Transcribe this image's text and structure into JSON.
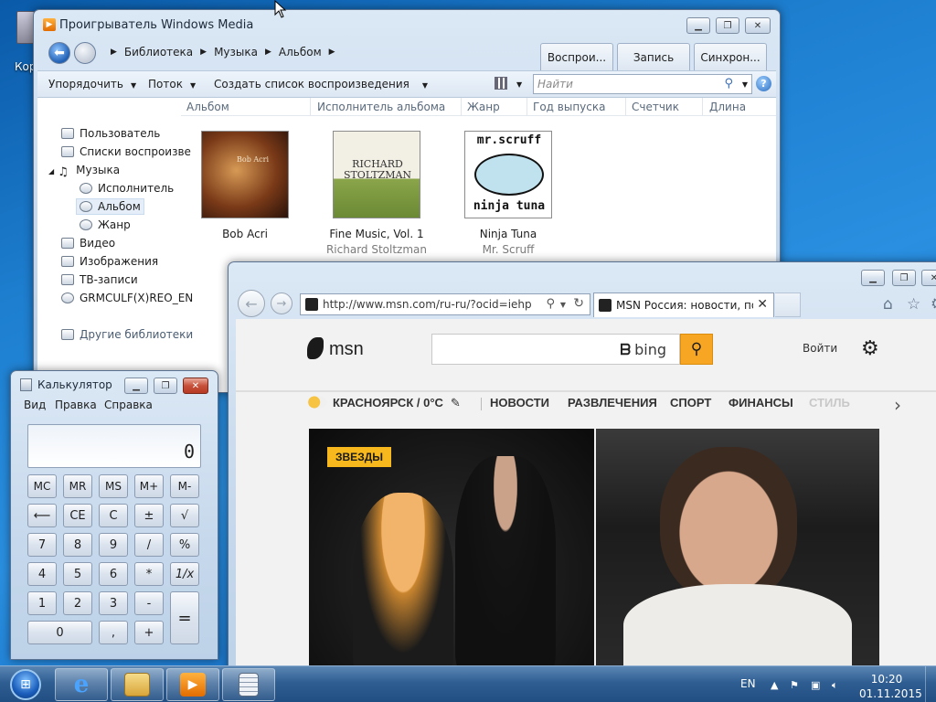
{
  "desktop": {
    "icon_label": "Кор"
  },
  "wmp": {
    "title": "Проигрыватель Windows Media",
    "breadcrumb": [
      "Библиотека",
      "Музыка",
      "Альбом"
    ],
    "tabs": [
      "Воспрои...",
      "Запись",
      "Синхрон..."
    ],
    "toolbar": {
      "organize": "Упорядочить",
      "stream": "Поток",
      "create_playlist": "Создать список воспроизведения",
      "search_placeholder": "Найти"
    },
    "sidebar": {
      "user": "Пользователь",
      "playlists": "Списки воспроизве",
      "music": "Музыка",
      "artist": "Исполнитель",
      "album": "Альбом",
      "genre": "Жанр",
      "video": "Видео",
      "images": "Изображения",
      "tv": "ТВ-записи",
      "disc": "GRMCULF(X)REO_EN",
      "other_libraries": "Другие библиотеки"
    },
    "columns": [
      "Альбом",
      "Исполнитель альбома",
      "Жанр",
      "Год выпуска",
      "Счетчик",
      "Длина"
    ],
    "albums": [
      {
        "title": "Bob Acri",
        "artist": ""
      },
      {
        "title": "Fine Music, Vol. 1",
        "artist": "Richard Stoltzman"
      },
      {
        "title": "Ninja Tuna",
        "artist": "Mr. Scruff"
      }
    ],
    "covers": {
      "bob_text": "Bob Acri",
      "rs_line1": "RICHARD",
      "rs_line2": "STOLTZMAN",
      "ms_line1": "mr.scruff",
      "ms_line2": "ninja tuna"
    }
  },
  "ie": {
    "url": "http://www.msn.com/ru-ru/?ocid=iehp",
    "tab_title": "MSN Россия: новости, пог...",
    "msn": {
      "logo": "msn",
      "search_brand": "bing",
      "signin": "Войти",
      "weather": "КРАСНОЯРСК / 0°C",
      "nav": [
        "НОВОСТИ",
        "РАЗВЛЕЧЕНИЯ",
        "СПОРТ",
        "ФИНАНСЫ",
        "СТИЛЬ"
      ],
      "badge": "ЗВЕЗДЫ"
    }
  },
  "calc": {
    "title": "Калькулятор",
    "menu": [
      "Вид",
      "Правка",
      "Справка"
    ],
    "display": "0",
    "keys": {
      "mc": "MC",
      "mr": "MR",
      "ms": "MS",
      "mplus": "M+",
      "mminus": "M-",
      "back": "⟵",
      "ce": "CE",
      "c": "C",
      "pm": "±",
      "sqrt": "√",
      "k7": "7",
      "k8": "8",
      "k9": "9",
      "div": "/",
      "pct": "%",
      "k4": "4",
      "k5": "5",
      "k6": "6",
      "mul": "*",
      "inv": "1/x",
      "k1": "1",
      "k2": "2",
      "k3": "3",
      "sub": "-",
      "eq": "=",
      "k0": "0",
      "dot": ",",
      "add": "+"
    }
  },
  "taskbar": {
    "lang": "EN",
    "time": "10:20",
    "date": "01.11.2015"
  },
  "colors": {
    "msn_accent": "#f6a623",
    "badge": "#f6b81c",
    "wmp_orange": "#e36c00"
  }
}
